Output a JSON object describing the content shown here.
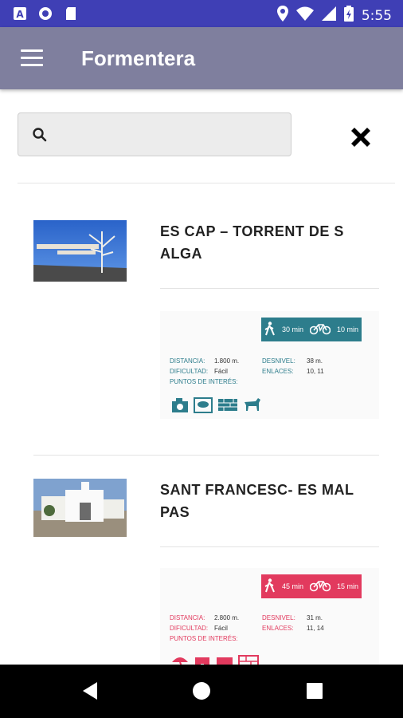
{
  "status_bar": {
    "time": "5:55",
    "icons": [
      "a-icon",
      "circle-icon",
      "sd-card-icon",
      "location-icon",
      "wifi-icon",
      "signal-icon",
      "battery-icon"
    ]
  },
  "app_bar": {
    "title": "Formentera",
    "menu_icon": "menu-icon"
  },
  "search": {
    "placeholder": "",
    "value": "",
    "close_icon": "close-icon"
  },
  "routes": [
    {
      "title": "ES CAP – TORRENT DE S ALGA",
      "accent": "#2d7d8c",
      "walk": "30 min",
      "bike": "10 min",
      "distancia_label": "DISTANCIA:",
      "distancia": "1.800 m.",
      "dificultad_label": "DIFICULTAD:",
      "dificultad": "Fácil",
      "desnivel_label": "DESNIVEL:",
      "desnivel": "38 m.",
      "enlaces_label": "ENLACES:",
      "enlaces": "10, 11",
      "puntos_label": "PUNTOS DE INTERÉS:"
    },
    {
      "title": "SANT FRANCESC- ES MAL PAS",
      "accent": "#e23a5e",
      "walk": "45 min",
      "bike": "15 min",
      "distancia_label": "DISTANCIA:",
      "distancia": "2.800 m.",
      "dificultad_label": "DIFICULTAD:",
      "dificultad": "Fácil",
      "desnivel_label": "DESNIVEL:",
      "desnivel": "31 m.",
      "enlaces_label": "ENLACES:",
      "enlaces": "11, 14",
      "puntos_label": "PUNTOS DE INTERÉS:"
    }
  ],
  "nav_bar": {
    "back_icon": "back-icon",
    "home_icon": "home-icon",
    "recents_icon": "recents-icon"
  }
}
